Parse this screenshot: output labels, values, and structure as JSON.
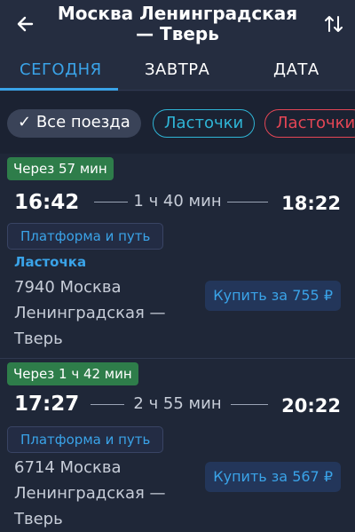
{
  "header": {
    "title_line1": "Москва Ленинградская",
    "title_line2": "— Тверь"
  },
  "tabs": [
    {
      "label": "СЕГОДНЯ",
      "active": true
    },
    {
      "label": "ЗАВТРА",
      "active": false
    },
    {
      "label": "ДАТА",
      "active": false
    }
  ],
  "filters": [
    {
      "label": "Все поезда",
      "check": "✓",
      "selected": true
    },
    {
      "label": "Ласточки",
      "selected": false
    },
    {
      "label": "Ласточки",
      "selected": false
    }
  ],
  "trips": [
    {
      "badge": "Через 57 мин",
      "departure": "16:42",
      "duration": "1 ч 40 мин",
      "arrival": "18:22",
      "platform_label": "Платформа и путь",
      "train_type": "Ласточка",
      "route_line1": "7940 Москва",
      "route_line2": "Ленинградская —",
      "route_line3": "Тверь",
      "buy_label": "Купить за 755 ₽"
    },
    {
      "badge": "Через 1 ч 42 мин",
      "departure": "17:27",
      "duration": "2 ч 55 мин",
      "arrival": "20:22",
      "platform_label": "Платформа и путь",
      "train_type": "",
      "route_line1": "6714 Москва",
      "route_line2": "Ленинградская —",
      "route_line3": "Тверь",
      "buy_label": "Купить за 567 ₽"
    }
  ],
  "colors": {
    "accent": "#3aa3e8",
    "badge_green": "#2e7d4a",
    "chip_red": "#e44655",
    "chip_cyan": "#2fb5d6"
  }
}
